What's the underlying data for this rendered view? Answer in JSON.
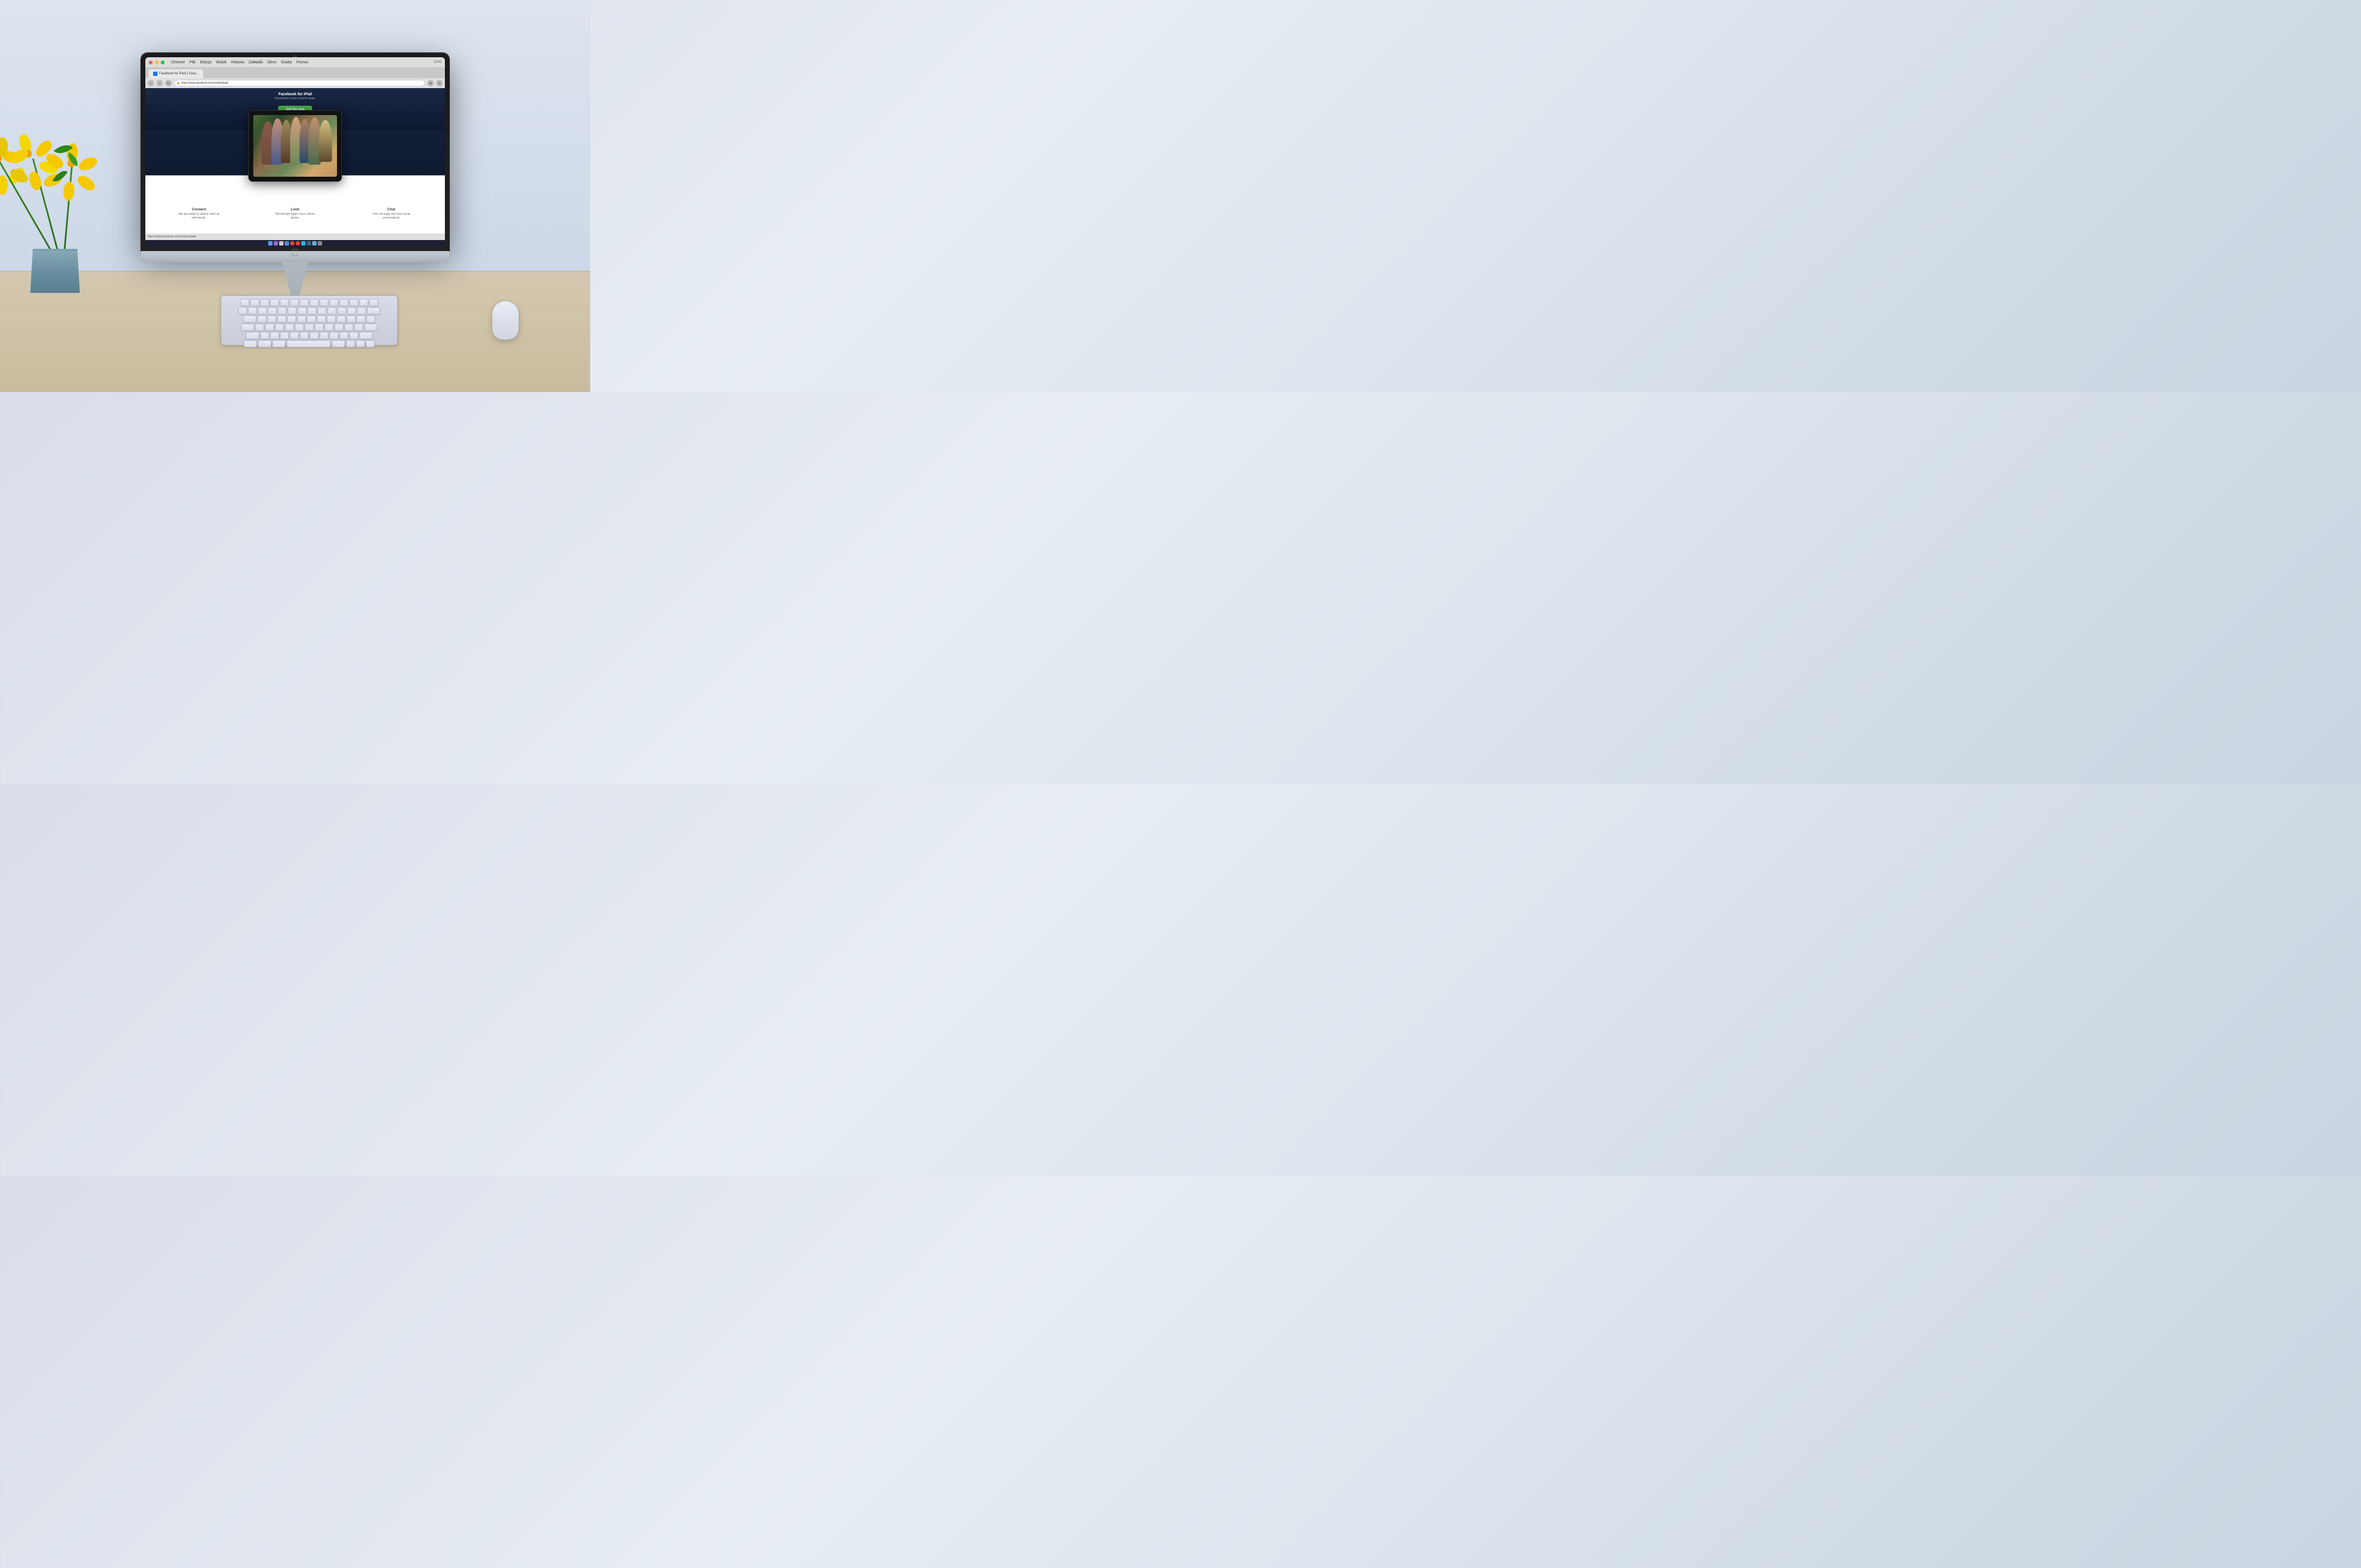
{
  "scene": {
    "background": "desk scene with iMac, plant, keyboard, and mouse"
  },
  "browser": {
    "menu_items": [
      "Chrome",
      "Plik",
      "Edycja",
      "Widok",
      "Historia",
      "Zakładki",
      "Okno",
      "Osoby",
      "Pomoc"
    ],
    "time": "13:42",
    "tab_title": "Facebook for iPad | Face...",
    "address": "https://www.facebook.com/mobile/ipad",
    "status_url": "https://www.facebook.com/mobile/ipad4"
  },
  "website": {
    "page_title": "Facebook for iPad",
    "page_subtitle": "Facebook is just a touch away.",
    "cta_button": "Get the App",
    "features": [
      {
        "title": "Connect",
        "description": "Tap and swipe to quickly catch up with friends."
      },
      {
        "title": "Look",
        "description": "Flip through bigger, more vibrant photos."
      },
      {
        "title": "Chat",
        "description": "Text, message and have group conversations."
      }
    ]
  },
  "dock": {
    "icons": [
      "finder",
      "launchpad",
      "system-prefs",
      "safari",
      "chrome",
      "firefox",
      "skype",
      "photoshop",
      "finder2",
      "trash"
    ]
  },
  "colors": {
    "imac_silver": "#b8c0c8",
    "screen_bg": "#1a2540",
    "fb_blue": "#1877f2",
    "get_app_green": "#4caf50",
    "desk_wood": "#c8bc9e",
    "wall_bg": "#dde4ee"
  }
}
